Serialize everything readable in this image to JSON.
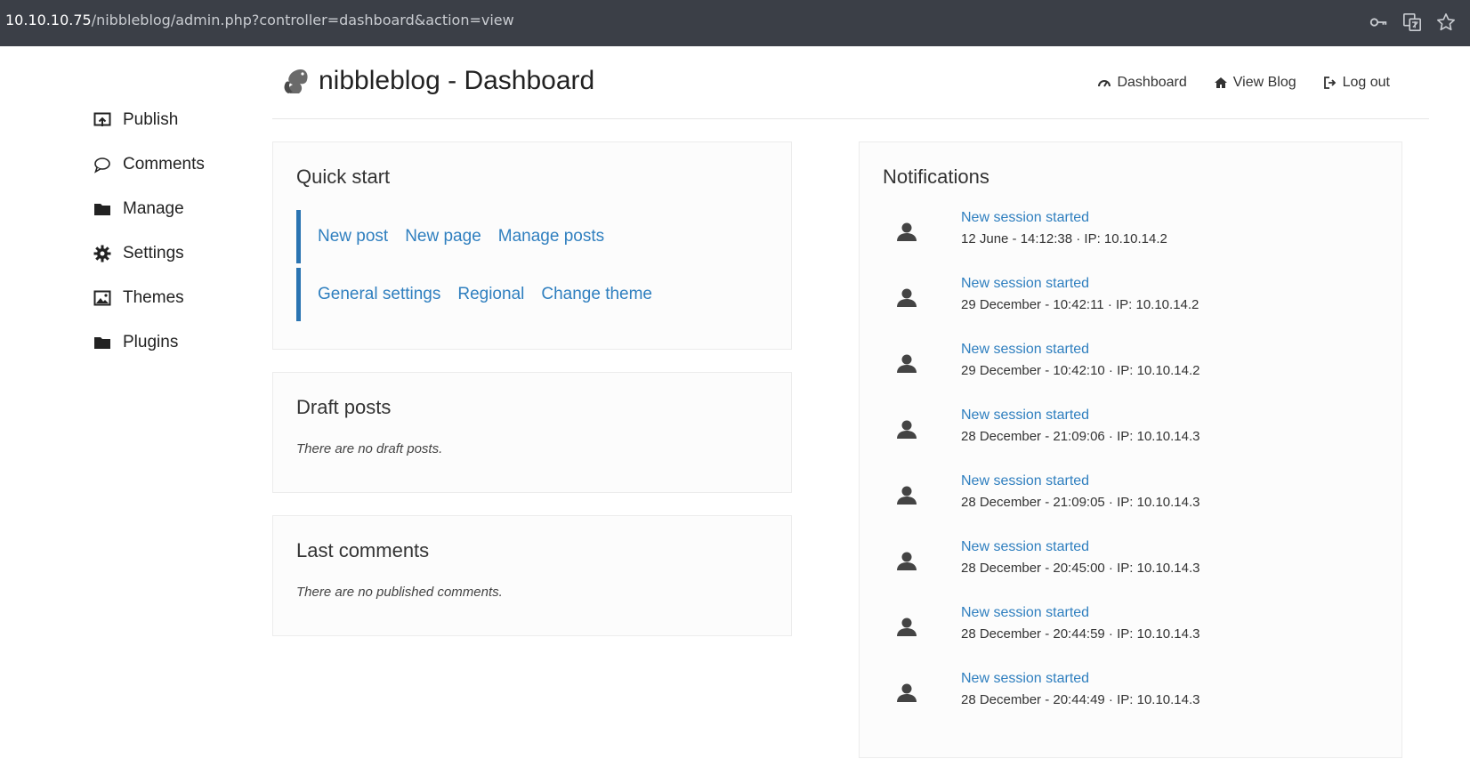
{
  "browser": {
    "url_host": "10.10.10.75",
    "url_path": "/nibbleblog/admin.php?controller=dashboard&action=view",
    "icons": [
      "key-icon",
      "translate-icon",
      "star-icon"
    ]
  },
  "sidebar": {
    "items": [
      {
        "label": "Publish",
        "icon": "publish-icon"
      },
      {
        "label": "Comments",
        "icon": "comment-icon"
      },
      {
        "label": "Manage",
        "icon": "folder-icon"
      },
      {
        "label": "Settings",
        "icon": "gear-icon"
      },
      {
        "label": "Themes",
        "icon": "image-icon"
      },
      {
        "label": "Plugins",
        "icon": "folder-icon"
      }
    ]
  },
  "header": {
    "title": "nibbleblog - Dashboard",
    "nav": [
      {
        "label": "Dashboard",
        "icon": "dashboard-icon"
      },
      {
        "label": "View Blog",
        "icon": "home-icon"
      },
      {
        "label": "Log out",
        "icon": "logout-icon"
      }
    ]
  },
  "quick_start": {
    "title": "Quick start",
    "row1": [
      "New post",
      "New page",
      "Manage posts"
    ],
    "row2": [
      "General settings",
      "Regional",
      "Change theme"
    ]
  },
  "draft_posts": {
    "title": "Draft posts",
    "empty": "There are no draft posts."
  },
  "last_comments": {
    "title": "Last comments",
    "empty": "There are no published comments."
  },
  "notifications": {
    "title": "Notifications",
    "items": [
      {
        "title": "New session started",
        "info": "12 June - 14:12:38 · IP: 10.10.14.2"
      },
      {
        "title": "New session started",
        "info": "29 December - 10:42:11 · IP: 10.10.14.2"
      },
      {
        "title": "New session started",
        "info": "29 December - 10:42:10 · IP: 10.10.14.2"
      },
      {
        "title": "New session started",
        "info": "28 December - 21:09:06 · IP: 10.10.14.3"
      },
      {
        "title": "New session started",
        "info": "28 December - 21:09:05 · IP: 10.10.14.3"
      },
      {
        "title": "New session started",
        "info": "28 December - 20:45:00 · IP: 10.10.14.3"
      },
      {
        "title": "New session started",
        "info": "28 December - 20:44:59 · IP: 10.10.14.3"
      },
      {
        "title": "New session started",
        "info": "28 December - 20:44:49 · IP: 10.10.14.3"
      }
    ]
  },
  "colors": {
    "link": "#2f7fbf",
    "accent_bar": "#2a74b2",
    "browser_bar": "#3b3f47"
  }
}
